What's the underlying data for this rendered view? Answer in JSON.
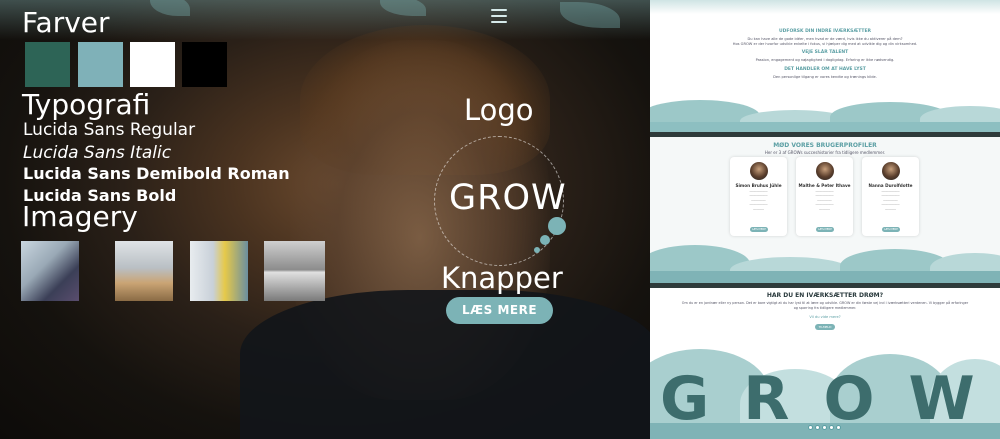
{
  "moodboard": {
    "colors_heading": "Farver",
    "colors": [
      "#2d6456",
      "#7fb1b8",
      "#ffffff",
      "#000000"
    ],
    "typography_heading": "Typografi",
    "fonts": [
      "Lucida Sans Regular",
      "Lucida Sans Italic",
      "Lucida Sans Demibold Roman",
      "Lucida Sans Bold"
    ],
    "imagery_heading": "Imagery",
    "logo_heading": "Logo",
    "logo_text": "GROW",
    "buttons_heading": "Knapper",
    "button_label": "LÆS MERE"
  },
  "mockup1": {
    "heading1": "UDFORSK DIN INDRE IVÆRKSÆTTER",
    "text1": "Du kan have alle de gode idéer, men hvad er de værd, hvis ikke du aktiverer på dem?",
    "text1b": "Hos GROW er der hvorfor udvikle enkelte i fokus, vi hjælper dig med at udvikle dig og din virksomhed.",
    "heading2": "VEJE SLÅR TALENT",
    "text2": "Passion, engagement og nøjagtighed i dagligdag. Erfaring er ikke nødvendig.",
    "heading3": "DET HANDLER OM AT HAVE LYST",
    "text3": "Den personlige tilgang er vores kendte og trænings kilde."
  },
  "mockup2": {
    "heading": "MØD VORES BRUGERPROFILER",
    "subheading": "Her er 3 af GROWs succeshistorier fra tidligere medlemmer.",
    "profiles": [
      {
        "name": "Simon Bruhus Jühle",
        "button": "LÆS MERE"
      },
      {
        "name": "Malthe & Peter Ithave",
        "button": "LÆS MERE"
      },
      {
        "name": "Nanna Durolfdotte",
        "button": "LÆS MERE"
      }
    ]
  },
  "mockup3": {
    "heading": "HAR DU EN IVÆRKSÆTTER DRØM?",
    "body": "Om du er en jordnær eller ny person. Det er bare vigtigt at du har lyst til at lære og udvikle. GROW er din første vej ind i iværksætteri verdenen. Vi bygger på erfaringer og sparring fra tidligere medlemmer.",
    "link": "Vil du vide mere?",
    "button": "TILMELD",
    "big_word": "GROW"
  }
}
